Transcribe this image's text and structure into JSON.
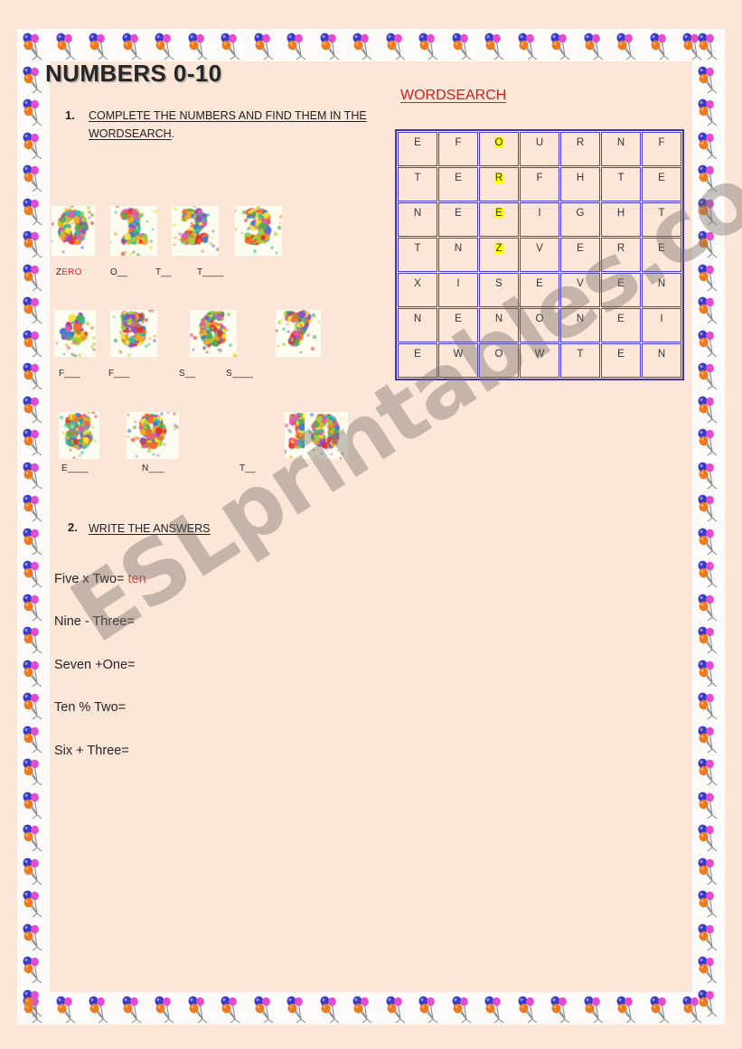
{
  "page": {
    "title": "NUMBERS 0-10",
    "background_color": "#fbe6d8",
    "border_band_color": "#fdfbfa",
    "watermark": "ESLprintables.com"
  },
  "border": {
    "icon": "balloon-bunch-icon",
    "balloon_colors": [
      "#3a3ac8",
      "#ef7a1e",
      "#e34ccf"
    ],
    "string_color": "#8a8a8a"
  },
  "sections": [
    {
      "number": "1.",
      "instruction": "COMPLETE THE NUMBERS AND FIND THEM IN THE WORDSEARCH",
      "instruction_line1": "COMPLETE THE NUMBERS AND FIND THEM IN THE",
      "instruction_line2": "WORDSEARCH",
      "trailing_period": "."
    },
    {
      "number": "2.",
      "instruction": "WRITE THE ANSWERS"
    }
  ],
  "wordsearch": {
    "title": "WORDSEARCH",
    "title_color": "#d02020",
    "grid_border_color": "#3d32c4",
    "cell_border_color": "#4a3fd0",
    "highlight_color": "#ffff00",
    "rows": 7,
    "cols": 7,
    "grid": [
      [
        "E",
        "F",
        "O",
        "U",
        "R",
        "N",
        "F"
      ],
      [
        "T",
        "E",
        "R",
        "F",
        "H",
        "T",
        "E"
      ],
      [
        "N",
        "E",
        "E",
        "I",
        "G",
        "H",
        "T"
      ],
      [
        "T",
        "N",
        "Z",
        "V",
        "E",
        "R",
        "E"
      ],
      [
        "X",
        "I",
        "S",
        "E",
        "V",
        "E",
        "N"
      ],
      [
        "N",
        "E",
        "N",
        "O",
        "N",
        "E",
        "I"
      ],
      [
        "E",
        "W",
        "O",
        "W",
        "T",
        "E",
        "N"
      ]
    ],
    "highlighted_cells": [
      {
        "row": 0,
        "col": 2,
        "letter": "O"
      },
      {
        "row": 1,
        "col": 2,
        "letter": "R"
      },
      {
        "row": 2,
        "col": 2,
        "letter": "E"
      },
      {
        "row": 3,
        "col": 2,
        "letter": "Z"
      }
    ]
  },
  "numbers": [
    {
      "digit": "0",
      "label_prefix": "Z",
      "label_suffix": "ERO",
      "label": "ZERO",
      "solved": true
    },
    {
      "digit": "1",
      "label": "O__",
      "solved": false
    },
    {
      "digit": "2",
      "label": "T__",
      "solved": false
    },
    {
      "digit": "3",
      "label": "T____",
      "solved": false
    },
    {
      "digit": "4",
      "label": "F___",
      "solved": false
    },
    {
      "digit": "5",
      "label": "F___",
      "solved": false
    },
    {
      "digit": "6",
      "label": "S__",
      "solved": false
    },
    {
      "digit": "7",
      "label": "S____",
      "solved": false
    },
    {
      "digit": "8",
      "label": "E____",
      "solved": false
    },
    {
      "digit": "9",
      "label": "N___",
      "solved": false
    },
    {
      "digit": "10",
      "label": "T__",
      "solved": false
    }
  ],
  "equations": [
    {
      "expression": "Five x Two=",
      "answer": "ten"
    },
    {
      "expression": "Nine - Three=",
      "answer": ""
    },
    {
      "expression": "Seven +One=",
      "answer": ""
    },
    {
      "expression": "Ten % Two=",
      "answer": ""
    },
    {
      "expression": "Six  + Three=",
      "answer": ""
    }
  ]
}
